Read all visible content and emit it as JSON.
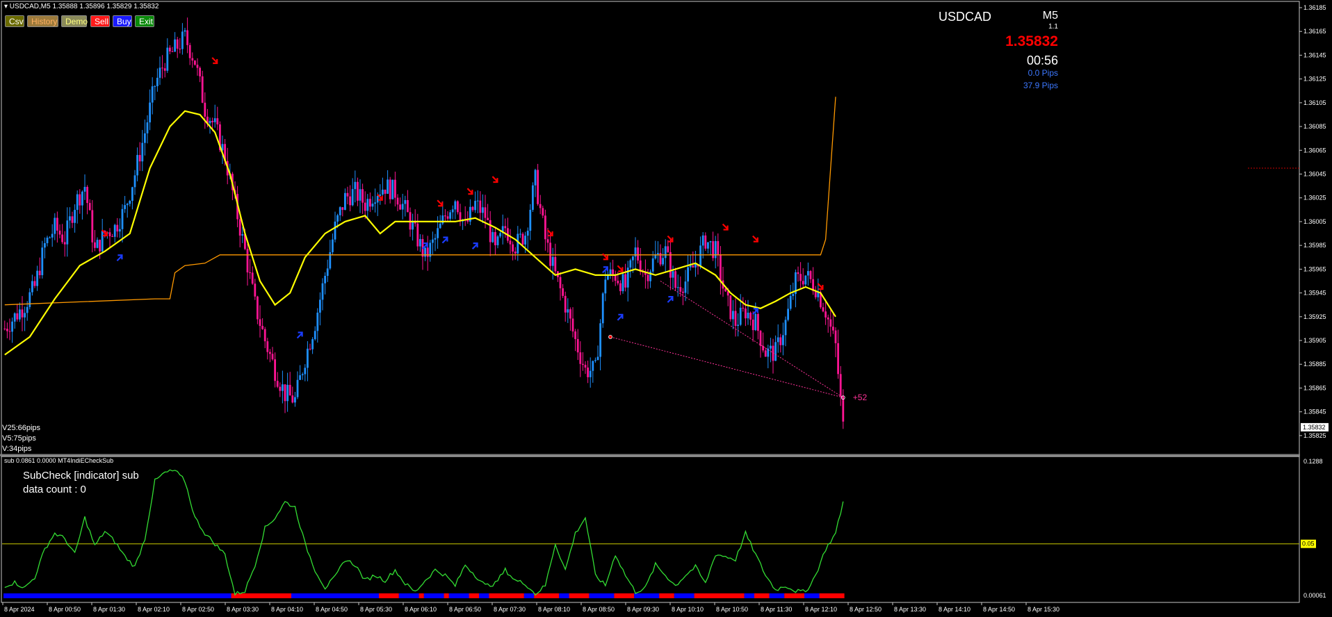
{
  "header": {
    "symbol_line": "▾ USDCAD,M5  1.35888 1.35896 1.35829 1.35832"
  },
  "toolbar": {
    "buttons": [
      {
        "label": "Csv",
        "bg": "#6b6b00",
        "fg": "#ffffff"
      },
      {
        "label": "History",
        "bg": "#9c7a3c",
        "fg": "#ffb060"
      },
      {
        "label": "Demo",
        "bg": "#8a8a5a",
        "fg": "#ffff80"
      },
      {
        "label": "Sell",
        "bg": "#ff1a1a",
        "fg": "#ffffff"
      },
      {
        "label": "Buy",
        "bg": "#1a1aff",
        "fg": "#ffffff"
      },
      {
        "label": "Exit",
        "bg": "#0a8a0a",
        "fg": "#ffffff"
      }
    ]
  },
  "info_panel": {
    "symbol": "USDCAD",
    "timeframe": "M5",
    "version": "1.1",
    "price": "1.35832",
    "countdown": "00:56",
    "spread": "0.0 Pips",
    "range": "37.9 Pips"
  },
  "volatility": {
    "v25": "V25:66pips",
    "v5": "V5:75pips",
    "v": "V:34pips"
  },
  "sub_window": {
    "header": "sub 0.0861 0.0000  MT4IndiECheckSub",
    "title": "SubCheck   [indicator] sub",
    "data_count": "data count : 0",
    "level_label": "0.05"
  },
  "colors": {
    "bull": "#1e90ff",
    "bear": "#ff1493",
    "ma_yellow": "#ffff00",
    "orange_line": "#ff9900",
    "osc_green": "#33dd33",
    "sell_arrow": "#ff0000",
    "buy_arrow": "#1a3cff"
  },
  "chart_data": [
    {
      "type": "candlestick",
      "symbol": "USDCAD",
      "timeframe": "M5",
      "ylim": [
        1.35815,
        1.36185
      ],
      "y_ticks": [
        "1.36185",
        "1.36165",
        "1.36145",
        "1.36125",
        "1.36105",
        "1.36085",
        "1.36065",
        "1.36045",
        "1.36025",
        "1.36005",
        "1.35985",
        "1.35965",
        "1.35945",
        "1.35925",
        "1.35905",
        "1.35885",
        "1.35865",
        "1.35845",
        "1.35825"
      ],
      "current_price_tag": "1.35832",
      "x_tick_labels": [
        "8 Apr 2024",
        "8 Apr 00:50",
        "8 Apr 01:30",
        "8 Apr 02:10",
        "8 Apr 02:50",
        "8 Apr 03:30",
        "8 Apr 04:10",
        "8 Apr 04:50",
        "8 Apr 05:30",
        "8 Apr 06:10",
        "8 Apr 06:50",
        "8 Apr 07:30",
        "8 Apr 08:10",
        "8 Apr 08:50",
        "8 Apr 09:30",
        "8 Apr 10:10",
        "8 Apr 10:50",
        "8 Apr 11:30",
        "8 Apr 12:10",
        "8 Apr 12:50",
        "8 Apr 13:30",
        "8 Apr 14:10",
        "8 Apr 14:50",
        "8 Apr 15:30"
      ],
      "path_profile_close": [
        [
          0,
          1.35915
        ],
        [
          4,
          1.35925
        ],
        [
          8,
          1.35935
        ],
        [
          12,
          1.3595
        ],
        [
          16,
          1.35985
        ],
        [
          20,
          1.36
        ],
        [
          24,
          1.3599
        ],
        [
          28,
          1.3602
        ],
        [
          32,
          1.36035
        ],
        [
          36,
          1.3598
        ],
        [
          40,
          1.35995
        ],
        [
          44,
          1.36
        ],
        [
          48,
          1.36015
        ],
        [
          52,
          1.36045
        ],
        [
          56,
          1.3608
        ],
        [
          60,
          1.3612
        ],
        [
          64,
          1.3614
        ],
        [
          68,
          1.3615
        ],
        [
          72,
          1.3616
        ],
        [
          76,
          1.3614
        ],
        [
          80,
          1.361
        ],
        [
          84,
          1.36085
        ],
        [
          88,
          1.3606
        ],
        [
          92,
          1.3602
        ],
        [
          96,
          1.3598
        ],
        [
          100,
          1.35935
        ],
        [
          104,
          1.35905
        ],
        [
          108,
          1.3588
        ],
        [
          112,
          1.3586
        ],
        [
          116,
          1.35855
        ],
        [
          120,
          1.3589
        ],
        [
          124,
          1.3592
        ],
        [
          128,
          1.3596
        ],
        [
          132,
          1.36
        ],
        [
          136,
          1.36025
        ],
        [
          140,
          1.3603
        ],
        [
          144,
          1.3602
        ],
        [
          148,
          1.3603
        ],
        [
          152,
          1.36035
        ],
        [
          156,
          1.3603
        ],
        [
          160,
          1.36015
        ],
        [
          164,
          1.35995
        ],
        [
          168,
          1.35975
        ],
        [
          172,
          1.3599
        ],
        [
          176,
          1.3601
        ],
        [
          180,
          1.36025
        ],
        [
          184,
          1.36
        ],
        [
          188,
          1.3602
        ],
        [
          192,
          1.3601
        ],
        [
          196,
          1.3598
        ],
        [
          200,
          1.36
        ],
        [
          204,
          1.35985
        ],
        [
          208,
          1.35995
        ],
        [
          212,
          1.3604
        ],
        [
          216,
          1.3599
        ],
        [
          220,
          1.3596
        ],
        [
          224,
          1.35935
        ],
        [
          228,
          1.35905
        ],
        [
          232,
          1.3588
        ],
        [
          236,
          1.3588
        ],
        [
          240,
          1.3596
        ],
        [
          244,
          1.3596
        ],
        [
          248,
          1.3595
        ],
        [
          252,
          1.3598
        ],
        [
          256,
          1.3596
        ],
        [
          260,
          1.35975
        ],
        [
          264,
          1.3598
        ],
        [
          268,
          1.3595
        ],
        [
          272,
          1.35955
        ],
        [
          276,
          1.3597
        ],
        [
          280,
          1.3599
        ],
        [
          284,
          1.3598
        ],
        [
          288,
          1.3594
        ],
        [
          292,
          1.3592
        ],
        [
          296,
          1.3593
        ],
        [
          300,
          1.3592
        ],
        [
          304,
          1.35895
        ],
        [
          308,
          1.35895
        ],
        [
          312,
          1.3592
        ],
        [
          316,
          1.35955
        ],
        [
          320,
          1.3596
        ],
        [
          324,
          1.3595
        ],
        [
          328,
          1.3593
        ],
        [
          332,
          1.359
        ],
        [
          335,
          1.35832
        ]
      ],
      "ma_yellow": [
        [
          0,
          1.35893
        ],
        [
          10,
          1.35908
        ],
        [
          20,
          1.3594
        ],
        [
          30,
          1.35968
        ],
        [
          40,
          1.3598
        ],
        [
          50,
          1.35995
        ],
        [
          58,
          1.3605
        ],
        [
          66,
          1.36085
        ],
        [
          72,
          1.36098
        ],
        [
          78,
          1.36095
        ],
        [
          84,
          1.3608
        ],
        [
          90,
          1.36045
        ],
        [
          96,
          1.35995
        ],
        [
          102,
          1.35955
        ],
        [
          108,
          1.35935
        ],
        [
          114,
          1.35945
        ],
        [
          120,
          1.35975
        ],
        [
          128,
          1.35995
        ],
        [
          136,
          1.36005
        ],
        [
          144,
          1.3601
        ],
        [
          150,
          1.35995
        ],
        [
          156,
          1.36005
        ],
        [
          164,
          1.36005
        ],
        [
          172,
          1.36005
        ],
        [
          180,
          1.36005
        ],
        [
          188,
          1.36008
        ],
        [
          196,
          1.36
        ],
        [
          204,
          1.3599
        ],
        [
          212,
          1.35975
        ],
        [
          220,
          1.3596
        ],
        [
          228,
          1.35965
        ],
        [
          236,
          1.3596
        ],
        [
          244,
          1.3596
        ],
        [
          252,
          1.35965
        ],
        [
          260,
          1.3596
        ],
        [
          268,
          1.35965
        ],
        [
          276,
          1.3597
        ],
        [
          284,
          1.3596
        ],
        [
          290,
          1.35945
        ],
        [
          296,
          1.35935
        ],
        [
          302,
          1.35932
        ],
        [
          308,
          1.35938
        ],
        [
          314,
          1.35945
        ],
        [
          320,
          1.3595
        ],
        [
          326,
          1.35945
        ],
        [
          332,
          1.35925
        ]
      ],
      "orange_line": [
        [
          0,
          1.35935
        ],
        [
          60,
          1.3594
        ],
        [
          66,
          1.3594
        ],
        [
          68,
          1.35962
        ],
        [
          72,
          1.35968
        ],
        [
          80,
          1.3597
        ],
        [
          86,
          1.35977
        ],
        [
          110,
          1.35977
        ],
        [
          200,
          1.35977
        ],
        [
          290,
          1.35977
        ],
        [
          326,
          1.35977
        ],
        [
          328,
          1.3599
        ],
        [
          332,
          1.3611
        ]
      ],
      "sell_arrows": [
        [
          84,
          1.3614
        ],
        [
          40,
          1.35995
        ],
        [
          150,
          1.36025
        ],
        [
          174,
          1.3602
        ],
        [
          186,
          1.3603
        ],
        [
          196,
          1.3604
        ],
        [
          218,
          1.35995
        ],
        [
          240,
          1.35975
        ],
        [
          246,
          1.35965
        ],
        [
          266,
          1.3599
        ],
        [
          288,
          1.36
        ],
        [
          300,
          1.3599
        ],
        [
          326,
          1.3595
        ]
      ],
      "buy_arrows": [
        [
          46,
          1.35975
        ],
        [
          118,
          1.3591
        ],
        [
          168,
          1.35985
        ],
        [
          176,
          1.3599
        ],
        [
          188,
          1.35985
        ],
        [
          240,
          1.35965
        ],
        [
          246,
          1.35925
        ],
        [
          266,
          1.3594
        ],
        [
          300,
          1.3593
        ]
      ],
      "dashed_lines": [
        [
          [
            242,
            1.35908
          ],
          [
            335,
            1.35857
          ]
        ],
        [
          [
            262,
            1.35955
          ],
          [
            335,
            1.35857
          ]
        ]
      ],
      "right_label": "+52",
      "horizontal_marker_price": 1.3605
    },
    {
      "type": "line",
      "name": "MT4IndiECheckSub",
      "ylim": [
        0.0,
        0.1288
      ],
      "y_ticks": [
        "0.1288",
        "0.05",
        "0.00061"
      ],
      "level": 0.05,
      "values_profile": [
        [
          0,
          0.01
        ],
        [
          4,
          0.013
        ],
        [
          8,
          0.008
        ],
        [
          12,
          0.018
        ],
        [
          16,
          0.045
        ],
        [
          20,
          0.06
        ],
        [
          24,
          0.055
        ],
        [
          28,
          0.04
        ],
        [
          32,
          0.075
        ],
        [
          36,
          0.048
        ],
        [
          40,
          0.062
        ],
        [
          44,
          0.052
        ],
        [
          48,
          0.038
        ],
        [
          52,
          0.028
        ],
        [
          56,
          0.055
        ],
        [
          60,
          0.11
        ],
        [
          64,
          0.118
        ],
        [
          68,
          0.12
        ],
        [
          72,
          0.11
        ],
        [
          76,
          0.075
        ],
        [
          80,
          0.06
        ],
        [
          84,
          0.05
        ],
        [
          88,
          0.04
        ],
        [
          92,
          0.002
        ],
        [
          96,
          0.005
        ],
        [
          100,
          0.03
        ],
        [
          104,
          0.065
        ],
        [
          108,
          0.075
        ],
        [
          112,
          0.09
        ],
        [
          116,
          0.085
        ],
        [
          120,
          0.05
        ],
        [
          124,
          0.025
        ],
        [
          128,
          0.008
        ],
        [
          132,
          0.018
        ],
        [
          136,
          0.035
        ],
        [
          140,
          0.03
        ],
        [
          144,
          0.015
        ],
        [
          148,
          0.02
        ],
        [
          152,
          0.015
        ],
        [
          156,
          0.025
        ],
        [
          160,
          0.012
        ],
        [
          164,
          0.004
        ],
        [
          168,
          0.015
        ],
        [
          172,
          0.025
        ],
        [
          176,
          0.02
        ],
        [
          180,
          0.01
        ],
        [
          184,
          0.03
        ],
        [
          188,
          0.02
        ],
        [
          192,
          0.01
        ],
        [
          196,
          0.012
        ],
        [
          200,
          0.025
        ],
        [
          204,
          0.015
        ],
        [
          208,
          0.012
        ],
        [
          212,
          0.002
        ],
        [
          216,
          0.01
        ],
        [
          220,
          0.05
        ],
        [
          224,
          0.025
        ],
        [
          228,
          0.06
        ],
        [
          232,
          0.075
        ],
        [
          236,
          0.02
        ],
        [
          240,
          0.01
        ],
        [
          244,
          0.04
        ],
        [
          248,
          0.02
        ],
        [
          252,
          0.004
        ],
        [
          256,
          0.008
        ],
        [
          260,
          0.03
        ],
        [
          264,
          0.02
        ],
        [
          268,
          0.01
        ],
        [
          272,
          0.02
        ],
        [
          276,
          0.028
        ],
        [
          280,
          0.012
        ],
        [
          284,
          0.04
        ],
        [
          288,
          0.038
        ],
        [
          292,
          0.035
        ],
        [
          296,
          0.06
        ],
        [
          300,
          0.04
        ],
        [
          304,
          0.02
        ],
        [
          308,
          0.006
        ],
        [
          312,
          0.01
        ],
        [
          316,
          0.005
        ],
        [
          320,
          0.004
        ],
        [
          324,
          0.02
        ],
        [
          328,
          0.045
        ],
        [
          332,
          0.06
        ],
        [
          335,
          0.09
        ]
      ],
      "bar_colors_profile": [
        [
          0,
          "blue"
        ],
        [
          91,
          "red"
        ],
        [
          115,
          "blue"
        ],
        [
          150,
          "red"
        ],
        [
          158,
          "blue"
        ],
        [
          166,
          "red"
        ],
        [
          168,
          "blue"
        ],
        [
          176,
          "red"
        ],
        [
          178,
          "blue"
        ],
        [
          186,
          "red"
        ],
        [
          190,
          "blue"
        ],
        [
          194,
          "red"
        ],
        [
          208,
          "blue"
        ],
        [
          212,
          "red"
        ],
        [
          222,
          "blue"
        ],
        [
          226,
          "red"
        ],
        [
          234,
          "blue"
        ],
        [
          244,
          "red"
        ],
        [
          252,
          "blue"
        ],
        [
          262,
          "red"
        ],
        [
          268,
          "blue"
        ],
        [
          276,
          "red"
        ],
        [
          296,
          "blue"
        ],
        [
          300,
          "red"
        ],
        [
          306,
          "blue"
        ],
        [
          312,
          "red"
        ],
        [
          320,
          "blue"
        ],
        [
          326,
          "red"
        ],
        [
          336,
          "red"
        ]
      ]
    }
  ]
}
